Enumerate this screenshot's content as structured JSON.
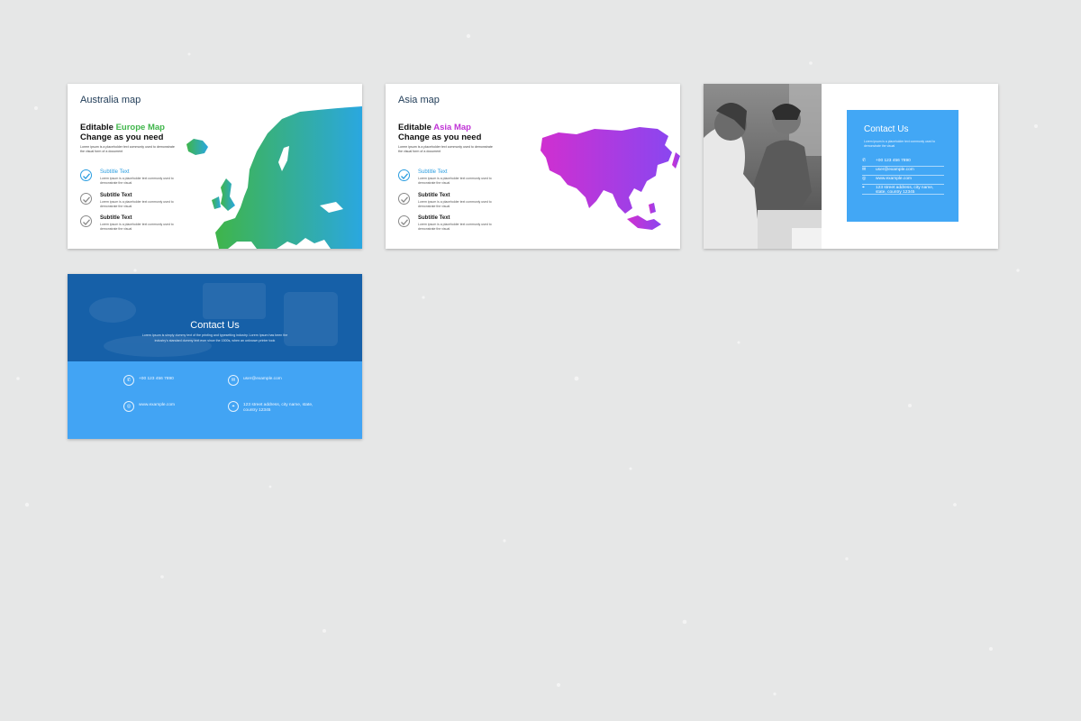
{
  "slides": {
    "europe": {
      "title": "Australia map",
      "heading_prefix": "Editable ",
      "heading_accent": "Europe Map",
      "heading_line2": "Change as you need",
      "description": "Lorem ipsum is a placeholder text commonly used to demonstrate the visual form of a document",
      "items": [
        {
          "title": "Subtitle Text",
          "desc": "Lorem ipsum is a placeholder text commonly used to demonstrate the visual"
        },
        {
          "title": "Subtitle Text",
          "desc": "Lorem ipsum is a placeholder text commonly used to demonstrate the visual"
        },
        {
          "title": "Subtitle Text",
          "desc": "Lorem ipsum is a placeholder text commonly used to demonstrate the visual"
        }
      ]
    },
    "asia": {
      "title": "Asia map",
      "heading_prefix": "Editable ",
      "heading_accent": "Asia Map",
      "heading_line2": "Change as you need",
      "description": "Lorem ipsum is a placeholder text commonly used to demonstrate the visual form of a document",
      "items": [
        {
          "title": "Subtitle Text",
          "desc": "Lorem ipsum is a placeholder text commonly used to demonstrate the visual"
        },
        {
          "title": "Subtitle Text",
          "desc": "Lorem ipsum is a placeholder text commonly used to demonstrate the visual"
        },
        {
          "title": "Subtitle Text",
          "desc": "Lorem ipsum is a placeholder text commonly used to demonstrate the visual"
        }
      ]
    },
    "contact_card": {
      "title": "Contact Us",
      "description": "Lorem ipsum is a placeholder text commonly used to demonstrate the visual",
      "rows": [
        {
          "icon": "phone-icon",
          "text": "+00 123 456 7890"
        },
        {
          "icon": "mail-icon",
          "text": "user@example.com"
        },
        {
          "icon": "globe-icon",
          "text": "www.example.com"
        },
        {
          "icon": "location-icon",
          "text": "123 street address, city name, state, country 12345"
        }
      ]
    },
    "contact_banner": {
      "title": "Contact Us",
      "description": "Lorem Ipsum is simply dummy text of the printing and typesetting industry. Lorem Ipsum has been the industry's standard dummy text ever since the 1500s, when an unknown printer took",
      "phone": "+00 123 456 7890",
      "email": "user@example.com",
      "web": "www.example.com",
      "address": "123 street address, city name, state, country 12345"
    }
  },
  "colors": {
    "background": "#e6e7e7",
    "europe_gradient": [
      "#3fb54a",
      "#2aa7e0"
    ],
    "asia_gradient": [
      "#d02fd0",
      "#8a46f0"
    ],
    "card_blue": "#42a7f5",
    "banner_dark": "#1660a8",
    "banner_light": "#42a4f4"
  }
}
